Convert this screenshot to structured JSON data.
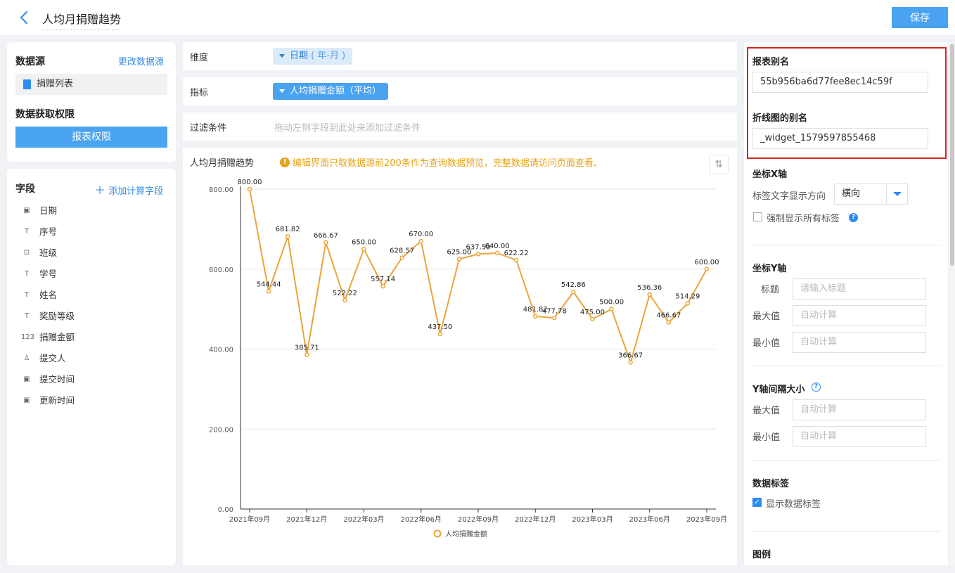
{
  "header": {
    "title": "人均月捐赠趋势",
    "save_label": "保存"
  },
  "datasource": {
    "heading": "数据源",
    "change_link": "更改数据源",
    "item": "捐赠列表",
    "permission_heading": "数据获取权限",
    "permission_button": "报表权限"
  },
  "fields": {
    "heading": "字段",
    "add_calc": "添加计算字段",
    "items": [
      {
        "icon": "date-icon",
        "glyph": "▣",
        "label": "日期"
      },
      {
        "icon": "text-icon",
        "glyph": "T",
        "label": "序号"
      },
      {
        "icon": "select-icon",
        "glyph": "⊡",
        "label": "班级"
      },
      {
        "icon": "text-icon",
        "glyph": "T",
        "label": "学号"
      },
      {
        "icon": "text-icon",
        "glyph": "T",
        "label": "姓名"
      },
      {
        "icon": "text-icon",
        "glyph": "T",
        "label": "奖励等级"
      },
      {
        "icon": "number-icon",
        "glyph": "123",
        "label": "捐赠金额"
      },
      {
        "icon": "user-icon",
        "glyph": "♙",
        "label": "提交人"
      },
      {
        "icon": "date-icon",
        "glyph": "▣",
        "label": "提交时间"
      },
      {
        "icon": "date-icon",
        "glyph": "▣",
        "label": "更新时间"
      }
    ]
  },
  "config": {
    "dimension_label": "维度",
    "dimension_chip": "日期",
    "dimension_sub": "( 年-月 )",
    "metric_label": "指标",
    "metric_chip": "人均捐赠金额（平均）",
    "filter_label": "过滤条件",
    "filter_placeholder": "拖动左侧字段到此处来添加过滤条件"
  },
  "chart_card": {
    "title": "人均月捐赠趋势",
    "warning": "编辑界面只取数据源前200条作为查询数据预览，完整数据请访问页面查看。"
  },
  "chart_data": {
    "type": "line",
    "color": "#eaa53a",
    "ylim": [
      0,
      800
    ],
    "yticks": [
      "800.00",
      "600.00",
      "400.00",
      "200.00",
      "0.00"
    ],
    "xtick_labels": [
      "2021年09月",
      "2021年12月",
      "2022年03月",
      "2022年06月",
      "2022年09月",
      "2022年12月",
      "2023年03月",
      "2023年06月",
      "2023年09月"
    ],
    "x": [
      "2021-09",
      "2021-10",
      "2021-11",
      "2021-12",
      "2022-01",
      "2022-02",
      "2022-03",
      "2022-04",
      "2022-05",
      "2022-06",
      "2022-07",
      "2022-08",
      "2022-09",
      "2022-10",
      "2022-11",
      "2022-12",
      "2023-01",
      "2023-02",
      "2023-03",
      "2023-04",
      "2023-05",
      "2023-06",
      "2023-07",
      "2023-08",
      "2023-09"
    ],
    "series": [
      {
        "name": "人均捐赠金额",
        "values": [
          800.0,
          544.44,
          681.82,
          385.71,
          666.67,
          522.22,
          650.0,
          557.14,
          628.57,
          670.0,
          437.5,
          625.0,
          637.5,
          640.0,
          622.22,
          481.82,
          477.78,
          542.86,
          475.0,
          500.0,
          366.67,
          536.36,
          466.67,
          514.29,
          600.0
        ],
        "labels": [
          "800.00",
          "544.44",
          "681.82",
          "385.71",
          "666.67",
          "522.22",
          "650.00",
          "557.14",
          "628.57",
          "670.00",
          "437.50",
          "625.00",
          "637.50",
          "640.00",
          "622.22",
          "481.82",
          "477.78",
          "542.86",
          "475.00",
          "500.00",
          "366.67",
          "536.36",
          "466.67",
          "514.29",
          "600.00"
        ],
        "label_shown": [
          true,
          true,
          true,
          true,
          true,
          true,
          true,
          true,
          true,
          true,
          true,
          true,
          true,
          true,
          true,
          true,
          true,
          true,
          true,
          true,
          true,
          true,
          true,
          true,
          true
        ]
      }
    ],
    "legend": "bottom-center",
    "grid": true
  },
  "settings": {
    "alias_heading": "报表别名",
    "alias_value": "55b956ba6d77fee8ec14c59f",
    "line_alias_heading": "折线图的别名",
    "line_alias_value": "_widget_1579597855468",
    "xaxis_heading": "坐标X轴",
    "label_direction_label": "标签文字显示方向",
    "label_direction_value": "横向",
    "force_show_labels": "强制显示所有标签",
    "yaxis_heading": "坐标Y轴",
    "title_label": "标题",
    "title_placeholder": "请输入标题",
    "max_label": "最大值",
    "min_label": "最小值",
    "auto_placeholder": "自动计算",
    "interval_heading": "Y轴间隔大小",
    "data_label_heading": "数据标签",
    "show_data_labels": "显示数据标签",
    "legend_heading": "图例"
  }
}
